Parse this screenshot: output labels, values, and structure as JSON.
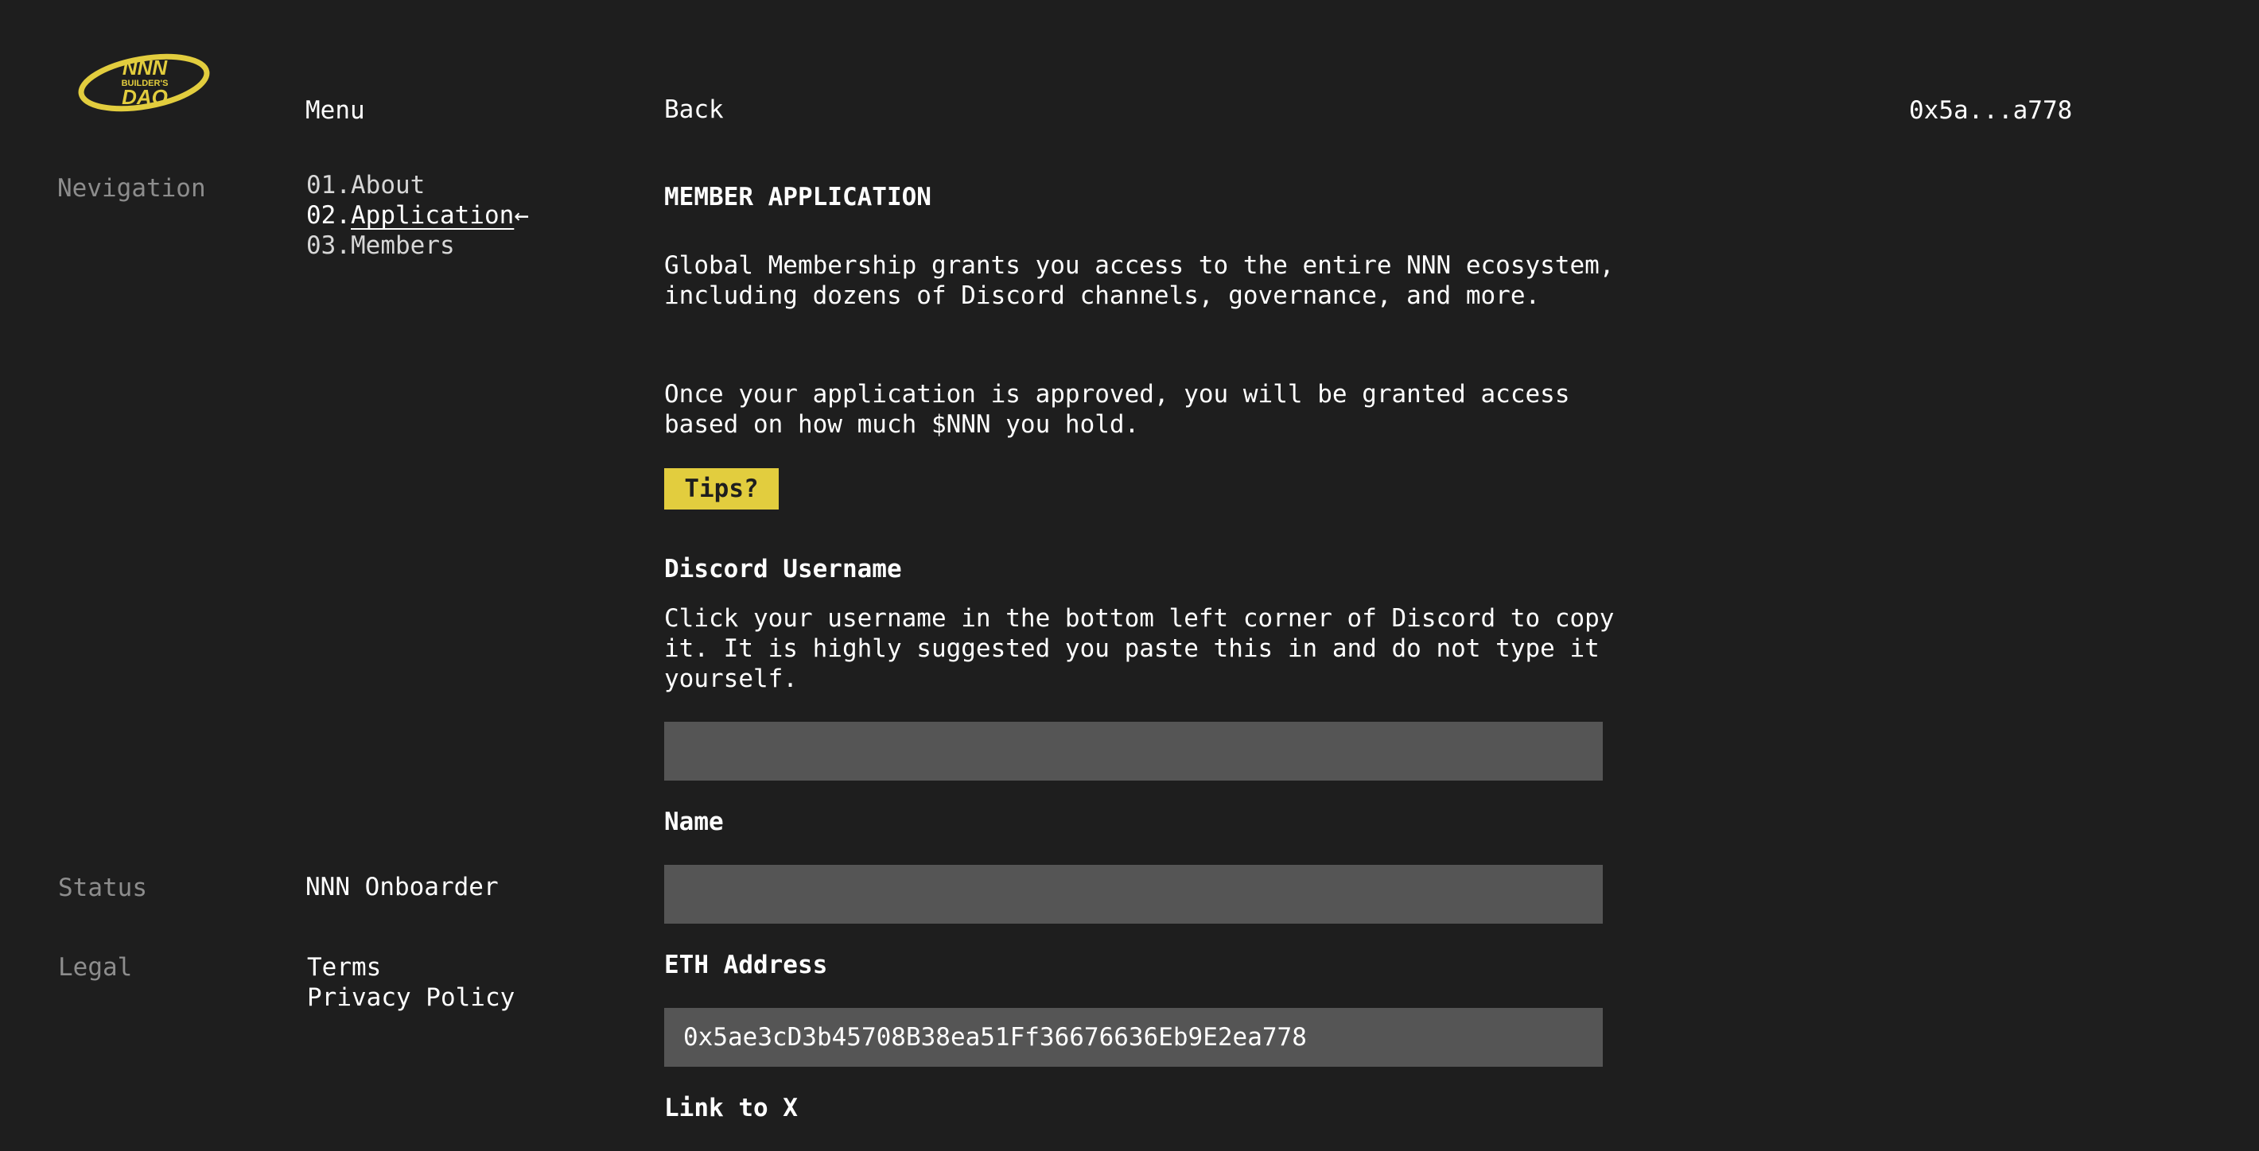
{
  "brand": {
    "logo_text_top": "NNN",
    "logo_text_mid": "BUILDER'S",
    "logo_text_bottom": "DAO",
    "accent_color": "#e2cd3e"
  },
  "header": {
    "menu_label": "Menu",
    "back_label": "Back",
    "wallet_address": "0x5a...a778"
  },
  "sidebar": {
    "navigation_label": "Nevigation",
    "nav_items": [
      {
        "number": "01.",
        "label": "About"
      },
      {
        "number": "02.",
        "label": "Application",
        "active_marker": "←"
      },
      {
        "number": "03.",
        "label": "Members"
      }
    ],
    "status_label": "Status",
    "status_value": "NNN Onboarder",
    "legal_label": "Legal",
    "legal_links": [
      "Terms",
      "Privacy Policy"
    ]
  },
  "main": {
    "title": "MEMBER APPLICATION",
    "intro_1": "Global Membership grants you access to the entire NNN ecosystem, including dozens of Discord channels, governance, and more.",
    "intro_2": "Once your application is approved, you will be granted access based on how much $NNN you hold.",
    "tips_label": "Tips?",
    "discord": {
      "label": "Discord Username",
      "help": "Click your username in the bottom left corner of Discord to copy it. It is highly suggested you paste this in and do not type it yourself.",
      "value": ""
    },
    "name": {
      "label": "Name",
      "value": ""
    },
    "eth": {
      "label": "ETH Address",
      "value": "0x5ae3cD3b45708B38ea51Ff36676636Eb9E2ea778"
    },
    "x_link": {
      "label": "Link to X"
    }
  }
}
